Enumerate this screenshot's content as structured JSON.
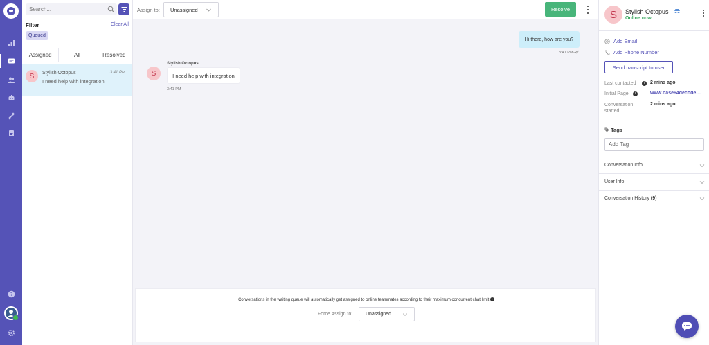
{
  "colors": {
    "brand": "#5553b7",
    "resolve": "#48b57a",
    "online": "#3aa75f",
    "selected_row": "#dff2fb",
    "avatar_bg": "#f7c6ca"
  },
  "rail": {
    "items": [
      {
        "name": "reports",
        "icon": "bar-chart-icon"
      },
      {
        "name": "conversations",
        "icon": "chat-icon",
        "active": true
      },
      {
        "name": "users",
        "icon": "users-icon"
      },
      {
        "name": "bot",
        "icon": "bot-icon"
      },
      {
        "name": "integrations",
        "icon": "plug-icon"
      },
      {
        "name": "documents",
        "icon": "docs-icon"
      }
    ],
    "bottom": [
      "help-icon",
      "profile-avatar",
      "settings-icon"
    ]
  },
  "list": {
    "search_placeholder": "Search...",
    "filter_title": "Filter",
    "clear_all": "Clear All",
    "chip": "Queued",
    "tabs": [
      "Assigned",
      "All",
      "Resolved"
    ],
    "conversation": {
      "avatar_letter": "S",
      "name": "Stylish Octopus",
      "time": "3:41 PM",
      "preview": "I need help with integration"
    }
  },
  "chat": {
    "assign_label": "Assign to:",
    "assign_value": "Unassigned",
    "resolve_label": "Resolve",
    "messages": {
      "outgoing": {
        "text": "Hi there, how are you?",
        "time": "3:41 PM"
      },
      "incoming": {
        "sender": "Stylish Octopus",
        "avatar_letter": "S",
        "text": "I need help with integration",
        "time": "3:41 PM"
      }
    },
    "footer": {
      "notice": "Conversations in the waiting queue will automatically get assigned to online teammates according to their maximum concurrent chat limit",
      "info_glyph": "i",
      "force_label": "Force Assign to:",
      "force_value": "Unassigned"
    }
  },
  "panel": {
    "avatar_letter": "S",
    "name": "Stylish Octopus",
    "status": "Online now",
    "add_email": "Add Email",
    "add_phone": "Add Phone Number",
    "send_transcript": "Send transcript to user",
    "last_contacted_label": "Last contacted",
    "last_contacted_value": "2 mins ago",
    "initial_page_label": "Initial Page",
    "initial_page_value": "www.base64decode....",
    "conv_started_label_1": "Conversation",
    "conv_started_label_2": "started",
    "conv_started_value": "2 mins ago",
    "tags_title": "Tags",
    "tag_placeholder": "Add Tag",
    "accordions": {
      "conversation_info": "Conversation Info",
      "user_info": "User Info",
      "history_label": "Conversation History",
      "history_count": "(9)"
    }
  }
}
